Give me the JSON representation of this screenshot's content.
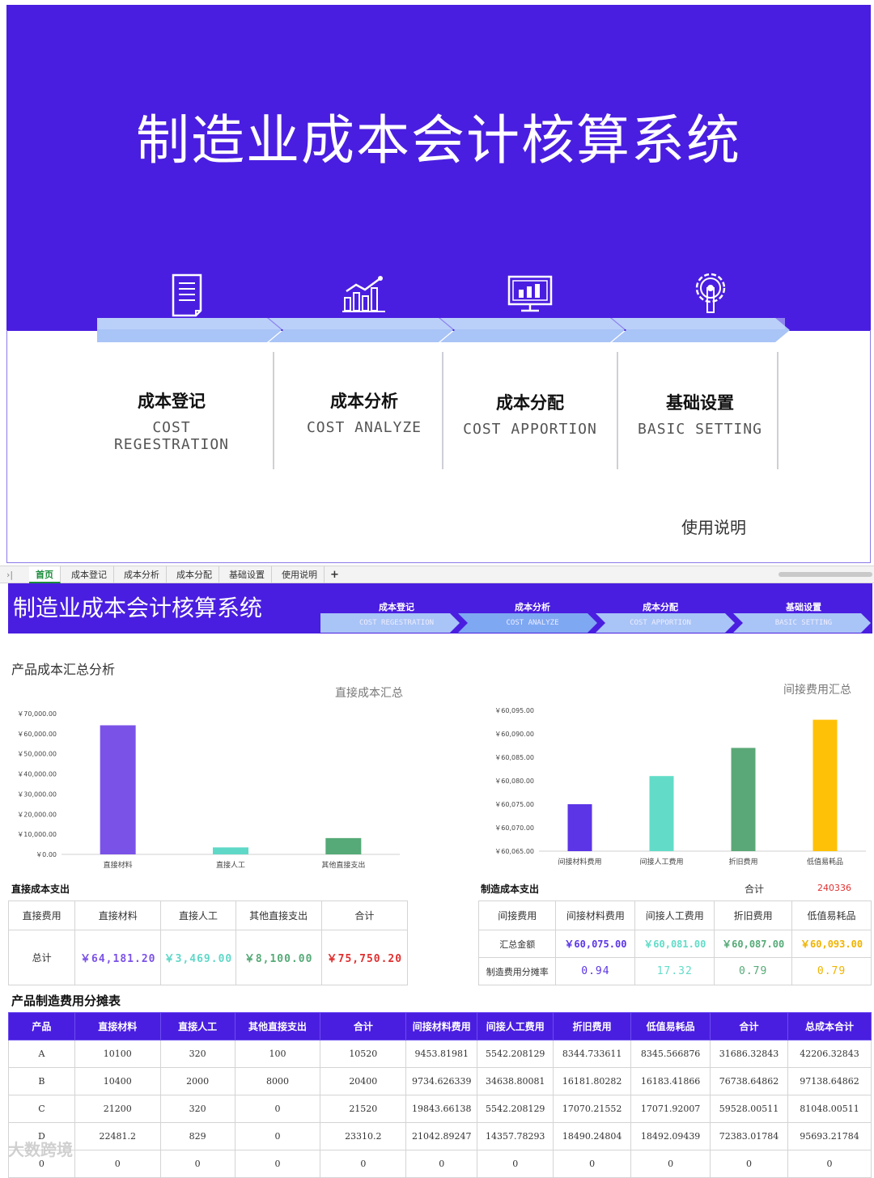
{
  "landing": {
    "title": "制造业成本会计核算系统",
    "menu": [
      {
        "cn": "成本登记",
        "en": "COST REGESTRATION",
        "icon": "document-icon"
      },
      {
        "cn": "成本分析",
        "en": "COST ANALYZE",
        "icon": "bar-chart-icon"
      },
      {
        "cn": "成本分配",
        "en": "COST APPORTION",
        "icon": "monitor-chart-icon"
      },
      {
        "cn": "基础设置",
        "en": "BASIC SETTING",
        "icon": "gear-icon"
      }
    ],
    "help": "使用说明"
  },
  "tabs": [
    "首页",
    "成本登记",
    "成本分析",
    "成本分配",
    "基础设置",
    "使用说明"
  ],
  "tab_add": "+",
  "dashboard": {
    "title": "制造业成本会计核算系统",
    "nav": [
      {
        "cn": "成本登记",
        "en": "COST REGESTRATION"
      },
      {
        "cn": "成本分析",
        "en": "COST ANALYZE"
      },
      {
        "cn": "成本分配",
        "en": "COST APPORTION"
      },
      {
        "cn": "基础设置",
        "en": "BASIC SETTING"
      }
    ],
    "section_title": "产品成本汇总分析"
  },
  "chart_data": [
    {
      "type": "bar",
      "title": "直接成本汇总",
      "categories": [
        "直接材料",
        "直接人工",
        "其他直接支出"
      ],
      "values": [
        64181.2,
        3469,
        8100
      ],
      "colors": [
        "#7b52e8",
        "#5fd8c8",
        "#55aa77"
      ],
      "ylim": [
        0,
        70000
      ],
      "yticks": [
        "￥70,000.00",
        "￥60,000.00",
        "￥50,000.00",
        "￥40,000.00",
        "￥30,000.00",
        "￥20,000.00",
        "￥10,000.00",
        "￥0.00"
      ]
    },
    {
      "type": "bar",
      "title": "间接费用汇总",
      "categories": [
        "间接材料费用",
        "间接人工费用",
        "折旧费用",
        "低值易耗品"
      ],
      "values": [
        60075,
        60081,
        60087,
        60093
      ],
      "colors": [
        "#5b35e6",
        "#62dcc8",
        "#5aa877",
        "#ffc107"
      ],
      "ylim": [
        60065,
        60095
      ],
      "yticks": [
        "￥60,095.00",
        "￥60,090.00",
        "￥60,085.00",
        "￥60,080.00",
        "￥60,075.00",
        "￥60,070.00",
        "￥60,065.00"
      ]
    }
  ],
  "direct_table": {
    "label": "直接成本支出",
    "headers": [
      "直接费用",
      "直接材料",
      "直接人工",
      "其他直接支出",
      "合计"
    ],
    "row_label": "总计",
    "values": [
      "￥64,181.20",
      "￥3,469.00",
      "￥8,100.00",
      "￥75,750.20"
    ],
    "colors": [
      "#7b52e8",
      "#5fd8c8",
      "#55aa77",
      "#e03030"
    ]
  },
  "indirect_table": {
    "label": "制造成本支出",
    "total_label": "合计",
    "total_value": "240336",
    "headers": [
      "间接费用",
      "间接材料费用",
      "间接人工费用",
      "折旧费用",
      "低值易耗品"
    ],
    "row1_label": "汇总金额",
    "row1": [
      "￥60,075.00",
      "￥60,081.00",
      "￥60,087.00",
      "￥60,093.00"
    ],
    "row2_label": "制造费用分摊率",
    "row2": [
      "0.94",
      "17.32",
      "0.79",
      "0.79"
    ],
    "colors": [
      "#5b35e6",
      "#62dcc8",
      "#55aa77",
      "#f0b400"
    ]
  },
  "alloc_table": {
    "label": "产品制造费用分摊表",
    "headers": [
      "产品",
      "直接材料",
      "直接人工",
      "其他直接支出",
      "合计",
      "间接材料费用",
      "间接人工费用",
      "折旧费用",
      "低值易耗品",
      "合计",
      "总成本合计"
    ],
    "rows": [
      [
        "A",
        "10100",
        "320",
        "100",
        "10520",
        "9453.81981",
        "5542.208129",
        "8344.733611",
        "8345.566876",
        "31686.32843",
        "42206.32843"
      ],
      [
        "B",
        "10400",
        "2000",
        "8000",
        "20400",
        "9734.626339",
        "34638.80081",
        "16181.80282",
        "16183.41866",
        "76738.64862",
        "97138.64862"
      ],
      [
        "C",
        "21200",
        "320",
        "0",
        "21520",
        "19843.66138",
        "5542.208129",
        "17070.21552",
        "17071.92007",
        "59528.00511",
        "81048.00511"
      ],
      [
        "D",
        "22481.2",
        "829",
        "0",
        "23310.2",
        "21042.89247",
        "14357.78293",
        "18490.24804",
        "18492.09439",
        "72383.01784",
        "95693.21784"
      ],
      [
        "0",
        "0",
        "0",
        "0",
        "0",
        "0",
        "0",
        "0",
        "0",
        "0",
        "0"
      ]
    ]
  },
  "watermark": "大数跨境"
}
